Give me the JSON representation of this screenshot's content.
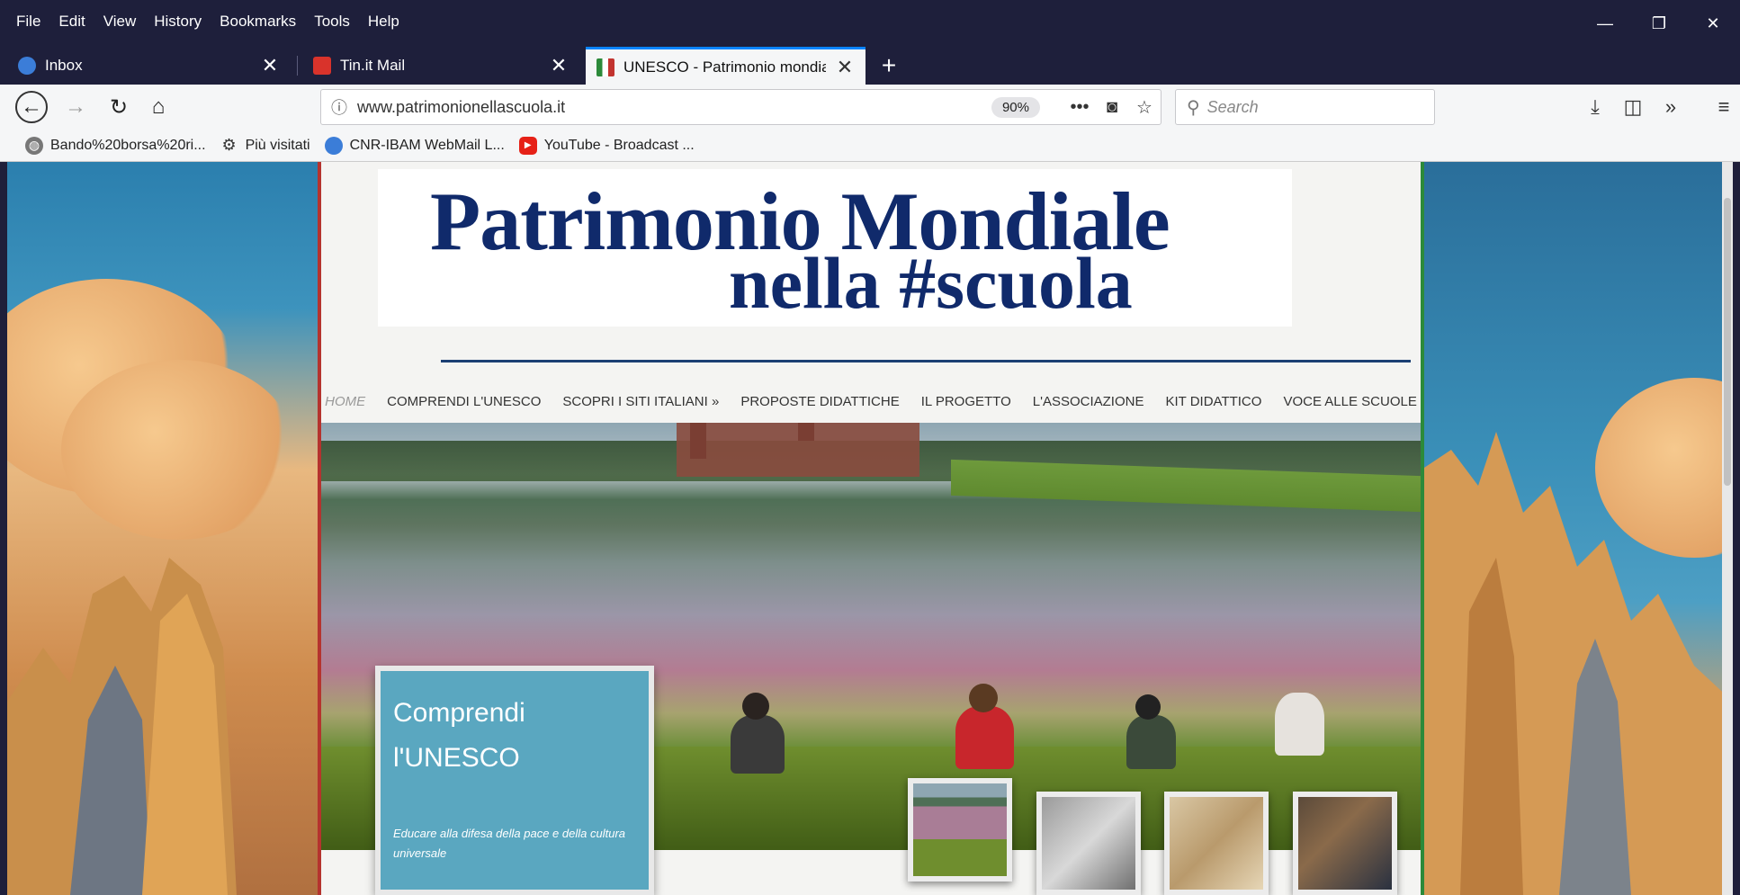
{
  "browser": {
    "menu": [
      "File",
      "Edit",
      "View",
      "History",
      "Bookmarks",
      "Tools",
      "Help"
    ],
    "window_controls": {
      "minimize": "—",
      "restore": "❐",
      "close": "✕"
    },
    "tabs": [
      {
        "label": "Inbox",
        "icon": "cloud-mail-icon",
        "color": "#3b7dd8"
      },
      {
        "label": "Tin.it Mail",
        "icon": "mail-icon",
        "color": "#d9332b"
      },
      {
        "label": "UNESCO - Patrimonio mondiale",
        "icon": "unesco-icon",
        "color": "#c2342f"
      }
    ],
    "new_tab": "+",
    "url": "www.patrimonionellascuola.it",
    "zoom": "90%",
    "search_placeholder": "Search",
    "bookmarks": [
      {
        "label": "Bando%20borsa%20ri...",
        "icon": "globe-icon"
      },
      {
        "label": "Più visitati",
        "icon": "gear-icon"
      },
      {
        "label": "CNR-IBAM WebMail L...",
        "icon": "cloud-mail-icon"
      },
      {
        "label": "YouTube - Broadcast ...",
        "icon": "youtube-icon"
      }
    ]
  },
  "site": {
    "logo_line1": "Patrimonio Mondiale",
    "logo_line2": "nella #scuola",
    "nav": [
      "HOME",
      "COMPRENDI L'UNESCO",
      "SCOPRI I SITI ITALIANI »",
      "PROPOSTE DIDATTICHE",
      "IL PROGETTO",
      "L'ASSOCIAZIONE",
      "KIT DIDATTICO",
      "VOCE ALLE SCUOLE"
    ],
    "feature": {
      "title": "Comprendi l'UNESCO",
      "subtitle": "Educare alla difesa della pace e della cultura universale"
    }
  },
  "colors": {
    "chrome_dark": "#1e1f3b",
    "accent_tab": "#0a84ff",
    "logo_blue": "#102a6b",
    "feature_box": "#5aa7c0"
  }
}
